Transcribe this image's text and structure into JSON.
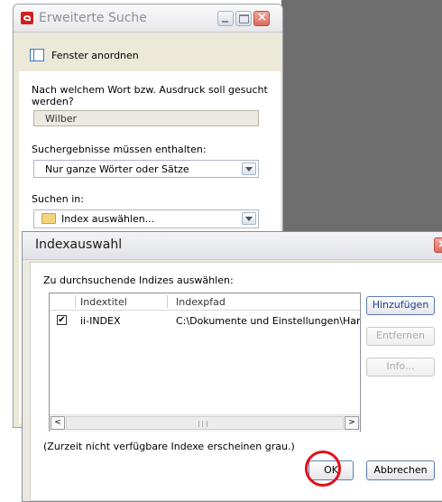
{
  "search_window": {
    "title": "Erweiterte Suche",
    "arrange_label": "Fenster anordnen",
    "question": "Nach welchem Wort bzw. Ausdruck soll gesucht werden?",
    "search_value": "Wilber",
    "must_contain_label": "Suchergebnisse müssen enthalten:",
    "must_contain_value": "Nur ganze Wörter oder Sätze",
    "search_in_label": "Suchen in:",
    "search_in_value": "Index auswählen..."
  },
  "index_dialog": {
    "title": "Indexauswahl",
    "choose_label": "Zu durchsuchende Indizes auswählen:",
    "columns": {
      "title": "Indextitel",
      "path": "Indexpfad"
    },
    "rows": [
      {
        "checked": true,
        "checkmark": "✔",
        "title": "ii-INDEX",
        "path": "C:\\Dokumente und Einstellungen\\Hans-Ju"
      }
    ],
    "buttons": {
      "add": "Hinzufügen",
      "remove": "Entfernen",
      "info": "Info...",
      "ok": "OK",
      "cancel": "Abbrechen"
    },
    "note": "(Zurzeit nicht verfügbare Indexe erscheinen grau.)",
    "scroll_left": "<",
    "scroll_right": ">"
  },
  "colors": {
    "highlight_circle": "#e0101b",
    "close_button": "#de6a5c",
    "desktop": "#6e6e6e"
  },
  "icons": [
    "pdf-icon",
    "window-arrange-icon",
    "folder-icon",
    "chevron-down-icon",
    "close-icon",
    "minimize-icon",
    "maximize-icon",
    "checkbox-icon"
  ]
}
